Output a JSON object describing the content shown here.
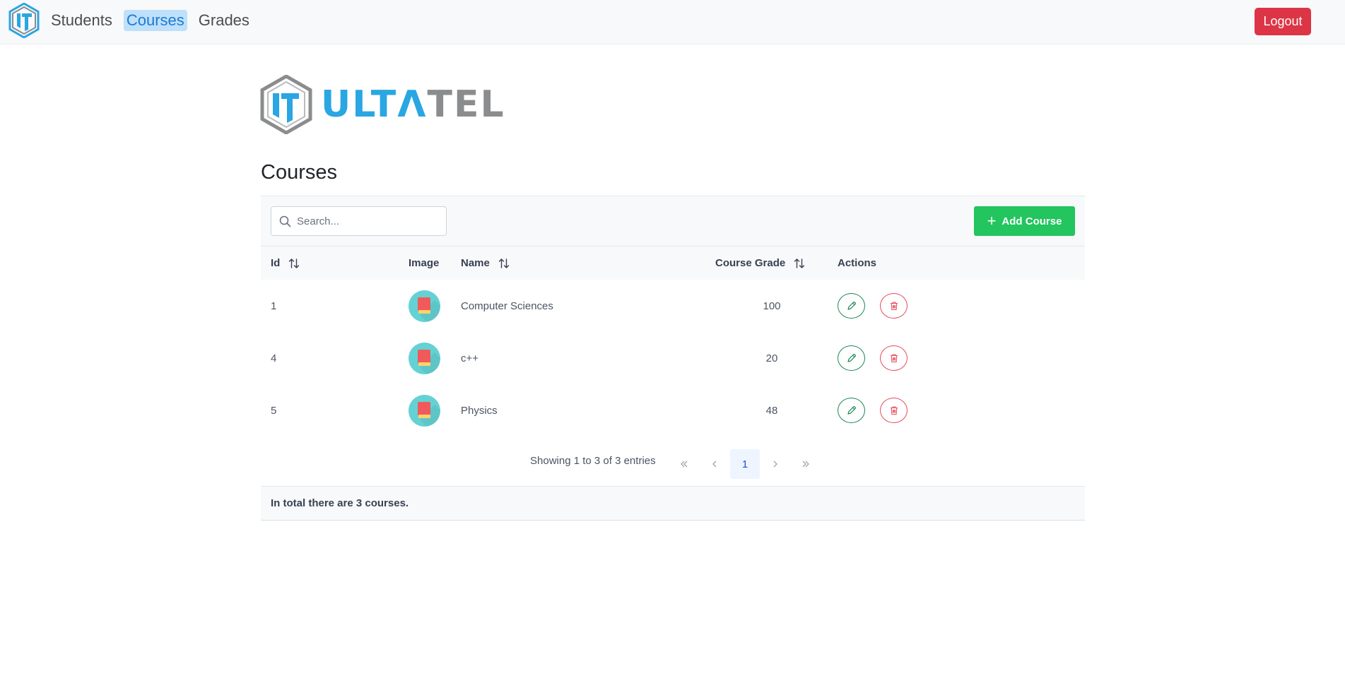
{
  "nav": {
    "items": [
      {
        "label": "Students",
        "active": false
      },
      {
        "label": "Courses",
        "active": true
      },
      {
        "label": "Grades",
        "active": false
      }
    ],
    "logout_label": "Logout"
  },
  "brand": {
    "text_blue": "ULTΛ",
    "text_gray": "TEL"
  },
  "page": {
    "title": "Courses"
  },
  "toolbar": {
    "search_placeholder": "Search...",
    "add_label": "Add Course"
  },
  "table": {
    "columns": {
      "id": "Id",
      "image": "Image",
      "name": "Name",
      "grade": "Course Grade",
      "actions": "Actions"
    },
    "rows": [
      {
        "id": "1",
        "name": "Computer Sciences",
        "grade": "100"
      },
      {
        "id": "4",
        "name": "c++",
        "grade": "20"
      },
      {
        "id": "5",
        "name": "Physics",
        "grade": "48"
      }
    ]
  },
  "pagination": {
    "info": "Showing 1 to 3 of 3 entries",
    "current_page": "1"
  },
  "footer": {
    "summary": "In total there are 3 courses."
  },
  "colors": {
    "accent": "#22c55e",
    "danger": "#dc3545",
    "active_nav_bg": "#bfe0fb",
    "brand_blue": "#2aa6e2",
    "brand_gray": "#8a8c8e"
  }
}
